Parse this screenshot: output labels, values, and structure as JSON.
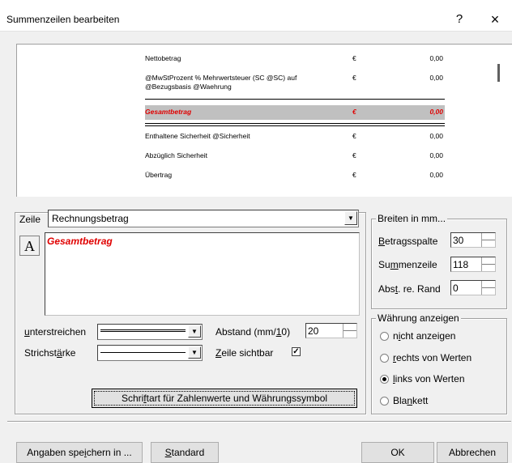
{
  "window": {
    "title": "Summenzeilen bearbeiten",
    "help_label": "?",
    "close_label": "×"
  },
  "preview": {
    "currency": "€",
    "rows": [
      {
        "label": "Nettobetrag",
        "currency": "€",
        "value": "0,00"
      },
      {
        "label": "@MwStProzent % Mehrwertsteuer (SC @SC) auf @Bezugsbasis @Waehrung",
        "currency": "€",
        "value": "0,00"
      },
      {
        "label": "Gesamtbetrag",
        "currency": "€",
        "value": "0,00"
      },
      {
        "label": "Enthaltene Sicherheit @Sicherheit",
        "currency": "€",
        "value": "0,00"
      },
      {
        "label": "Abzüglich Sicherheit",
        "currency": "€",
        "value": "0,00"
      },
      {
        "label": "Übertrag",
        "currency": "€",
        "value": "0,00"
      }
    ]
  },
  "zeile": {
    "group_label": "Zeile",
    "selected": "Rechnungsbetrag",
    "font_button": "A",
    "text": "Gesamtbetrag",
    "underline_label_pre": "",
    "underline_label_u": "u",
    "underline_label_post": "nterstreichen",
    "stroke_label_pre": "Strichst",
    "stroke_label_u": "ä",
    "stroke_label_post": "rke",
    "abstand_label_pre": "Abstand (mm/",
    "abstand_label_u": "1",
    "abstand_label_post": "0)",
    "abstand_value": "20",
    "visible_label_u": "Z",
    "visible_label_post": "eile sichtbar",
    "visible_checked": "✓",
    "font_numbers_pre": "Schri",
    "font_numbers_u": "f",
    "font_numbers_post": "tart für Zahlenwerte und Währungssymbol"
  },
  "breiten": {
    "group_label": "Breiten in mm...",
    "betrag_u": "B",
    "betrag_post": "etragsspalte",
    "betrag_value": "30",
    "summen_pre": "Su",
    "summen_u": "m",
    "summen_post": "menzeile",
    "summen_value": "118",
    "abst_pre": "Abs",
    "abst_u": "t",
    "abst_post": ". re. Rand",
    "abst_value": "0"
  },
  "waehrung": {
    "group_label": "Währung anzeigen",
    "options": [
      {
        "pre": "n",
        "u": "i",
        "post": "cht anzeigen",
        "selected": false
      },
      {
        "pre": "",
        "u": "r",
        "post": "echts von Werten",
        "selected": false
      },
      {
        "pre": "",
        "u": "l",
        "post": "inks von Werten",
        "selected": true
      },
      {
        "pre": "Bla",
        "u": "n",
        "post": "kett",
        "selected": false
      }
    ]
  },
  "footer": {
    "save_pre": "Angaben spe",
    "save_u": "i",
    "save_post": "chern in ...",
    "standard_u": "S",
    "standard_post": "tandard",
    "ok_label": "OK",
    "cancel_label": "Abbrechen"
  },
  "colors": {
    "accent_red": "#e00000",
    "highlight_gray": "#c0c0c0",
    "dialog_bg": "#f0f0f0"
  }
}
